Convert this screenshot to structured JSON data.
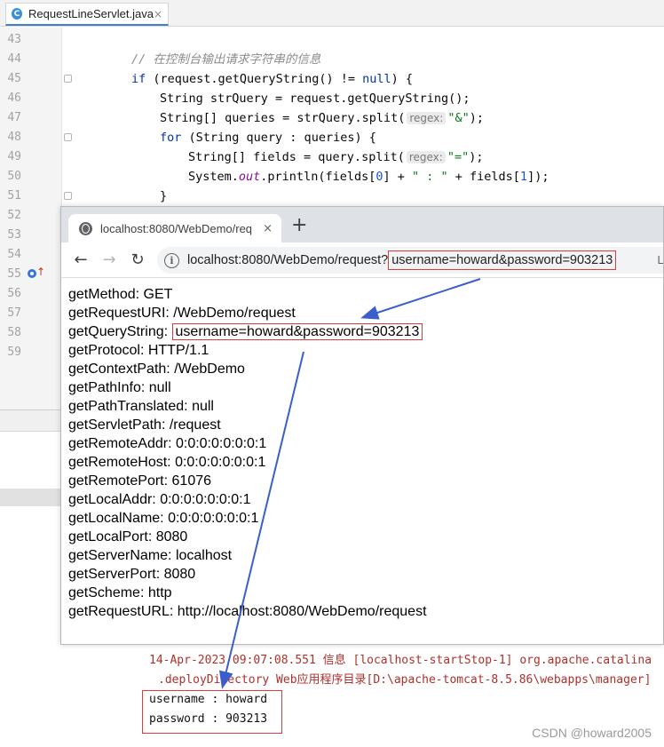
{
  "ide": {
    "tab": {
      "icon_letter": "C",
      "title": "RequestLineServlet.java",
      "close": "×"
    },
    "code_lines": [
      {
        "no": "43",
        "text": ""
      },
      {
        "no": "44",
        "text": "// 在控制台输出请求字符串的信息"
      },
      {
        "no": "45",
        "text": "if (request.getQueryString() != null) {"
      },
      {
        "no": "46",
        "text": "String strQuery = request.getQueryString();"
      },
      {
        "no": "47",
        "text": "String[] queries = strQuery.split(\"&\");"
      },
      {
        "no": "48",
        "text": "for (String query : queries) {"
      },
      {
        "no": "49",
        "text": "String[] fields = query.split(\"=\");"
      },
      {
        "no": "50",
        "text": "System.out.println(fields[0] + \" : \" + fields[1]);"
      },
      {
        "no": "51",
        "text": "}"
      },
      {
        "no": "52",
        "text": ""
      },
      {
        "no": "53",
        "text": ""
      },
      {
        "no": "54",
        "text": ""
      },
      {
        "no": "55",
        "text": ""
      },
      {
        "no": "56",
        "text": ""
      },
      {
        "no": "57",
        "text": ""
      },
      {
        "no": "58",
        "text": ""
      },
      {
        "no": "59",
        "text": ""
      }
    ],
    "param_hint": "regex:",
    "console": {
      "line1": "14-Apr-2023 09:07:08.551 信息 [localhost-startStop-1] org.apache.catalina",
      "line2": ".deployDirectory Web应用程序目录[D:\\apache-tomcat-8.5.86\\webapps\\manager]",
      "output": [
        "username : howard",
        "password : 903213"
      ]
    }
  },
  "browser": {
    "tab_title": "localhost:8080/WebDemo/req",
    "tab_close": "×",
    "new_tab": "+",
    "url_base": "localhost:8080/WebDemo/request?",
    "url_query": "username=howard&password=903213",
    "omnibox_right": "L",
    "lines": [
      {
        "label": "getMethod:",
        "value": "GET"
      },
      {
        "label": "getRequestURI:",
        "value": "/WebDemo/request"
      },
      {
        "label": "getQueryString:",
        "value": "username=howard&password=903213"
      },
      {
        "label": "getProtocol:",
        "value": "HTTP/1.1"
      },
      {
        "label": "getContextPath:",
        "value": "/WebDemo"
      },
      {
        "label": "getPathInfo:",
        "value": "null"
      },
      {
        "label": "getPathTranslated:",
        "value": "null"
      },
      {
        "label": "getServletPath:",
        "value": "/request"
      },
      {
        "label": "getRemoteAddr:",
        "value": "0:0:0:0:0:0:0:1"
      },
      {
        "label": "getRemoteHost:",
        "value": "0:0:0:0:0:0:0:1"
      },
      {
        "label": "getRemotePort:",
        "value": "61076"
      },
      {
        "label": "getLocalAddr:",
        "value": "0:0:0:0:0:0:0:1"
      },
      {
        "label": "getLocalName:",
        "value": "0:0:0:0:0:0:0:1"
      },
      {
        "label": "getLocalPort:",
        "value": "8080"
      },
      {
        "label": "getServerName:",
        "value": "localhost"
      },
      {
        "label": "getServerPort:",
        "value": "8080"
      },
      {
        "label": "getScheme:",
        "value": "http"
      },
      {
        "label": "getRequestURL:",
        "value": "http://localhost:8080/WebDemo/request"
      }
    ]
  },
  "watermark": "CSDN @howard2005",
  "colors": {
    "annotation_box": "#dd3b3b",
    "annotation_arrow": "#3a5fcd",
    "keyword": "#0033b3",
    "string": "#067d17"
  }
}
